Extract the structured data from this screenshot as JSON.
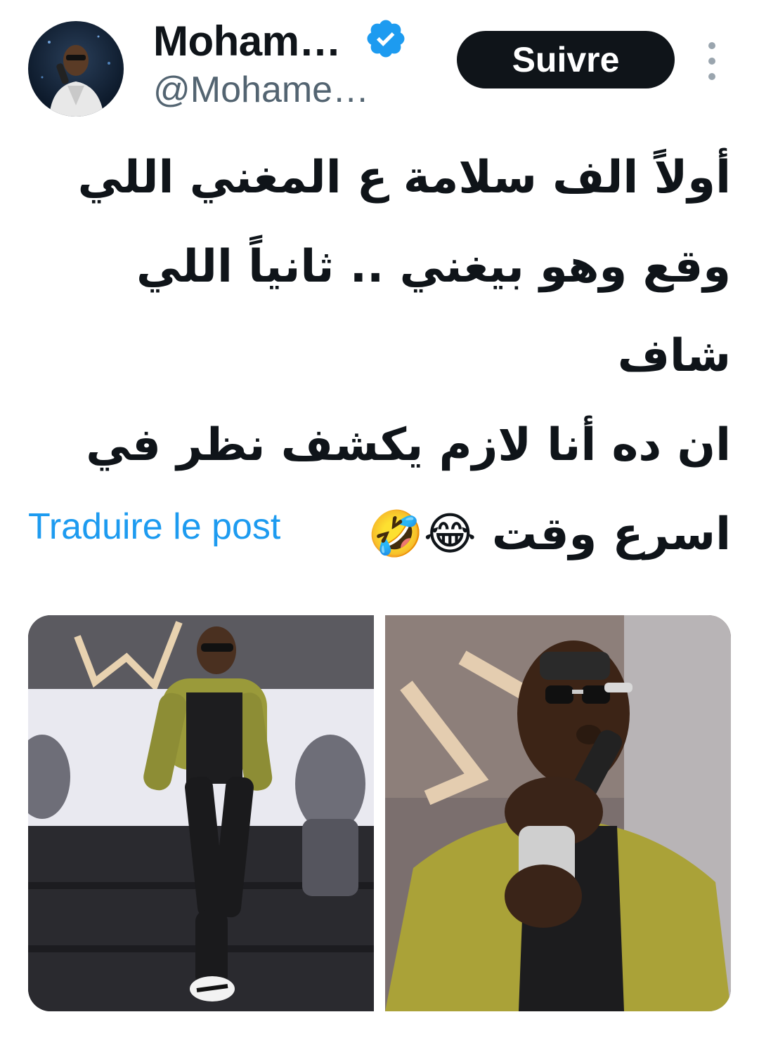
{
  "post": {
    "author": {
      "display_name": "Moham…",
      "handle": "@Mohame…",
      "verified_icon": "verified-badge-icon",
      "avatar_icon": "avatar-photo"
    },
    "follow_label": "Suivre",
    "more_icon": "more-vertical-icon",
    "text": "أولاً الف سلامة ع المغني اللي\nوقع وهو بيغني .. ثانياً اللي شاف\nان ده أنا لازم يكشف نظر في\nاسرع وقت 😂🤣",
    "translate_label": "Traduire le post",
    "media": [
      {
        "type": "photo",
        "icon": "photo-singer-full-body"
      },
      {
        "type": "photo",
        "icon": "photo-singer-closeup"
      }
    ]
  },
  "colors": {
    "text_primary": "#0f1419",
    "text_secondary": "#536471",
    "link": "#1d9bf0",
    "verified": "#1d9bf0",
    "button_bg": "#0f1419",
    "button_text": "#ffffff"
  }
}
